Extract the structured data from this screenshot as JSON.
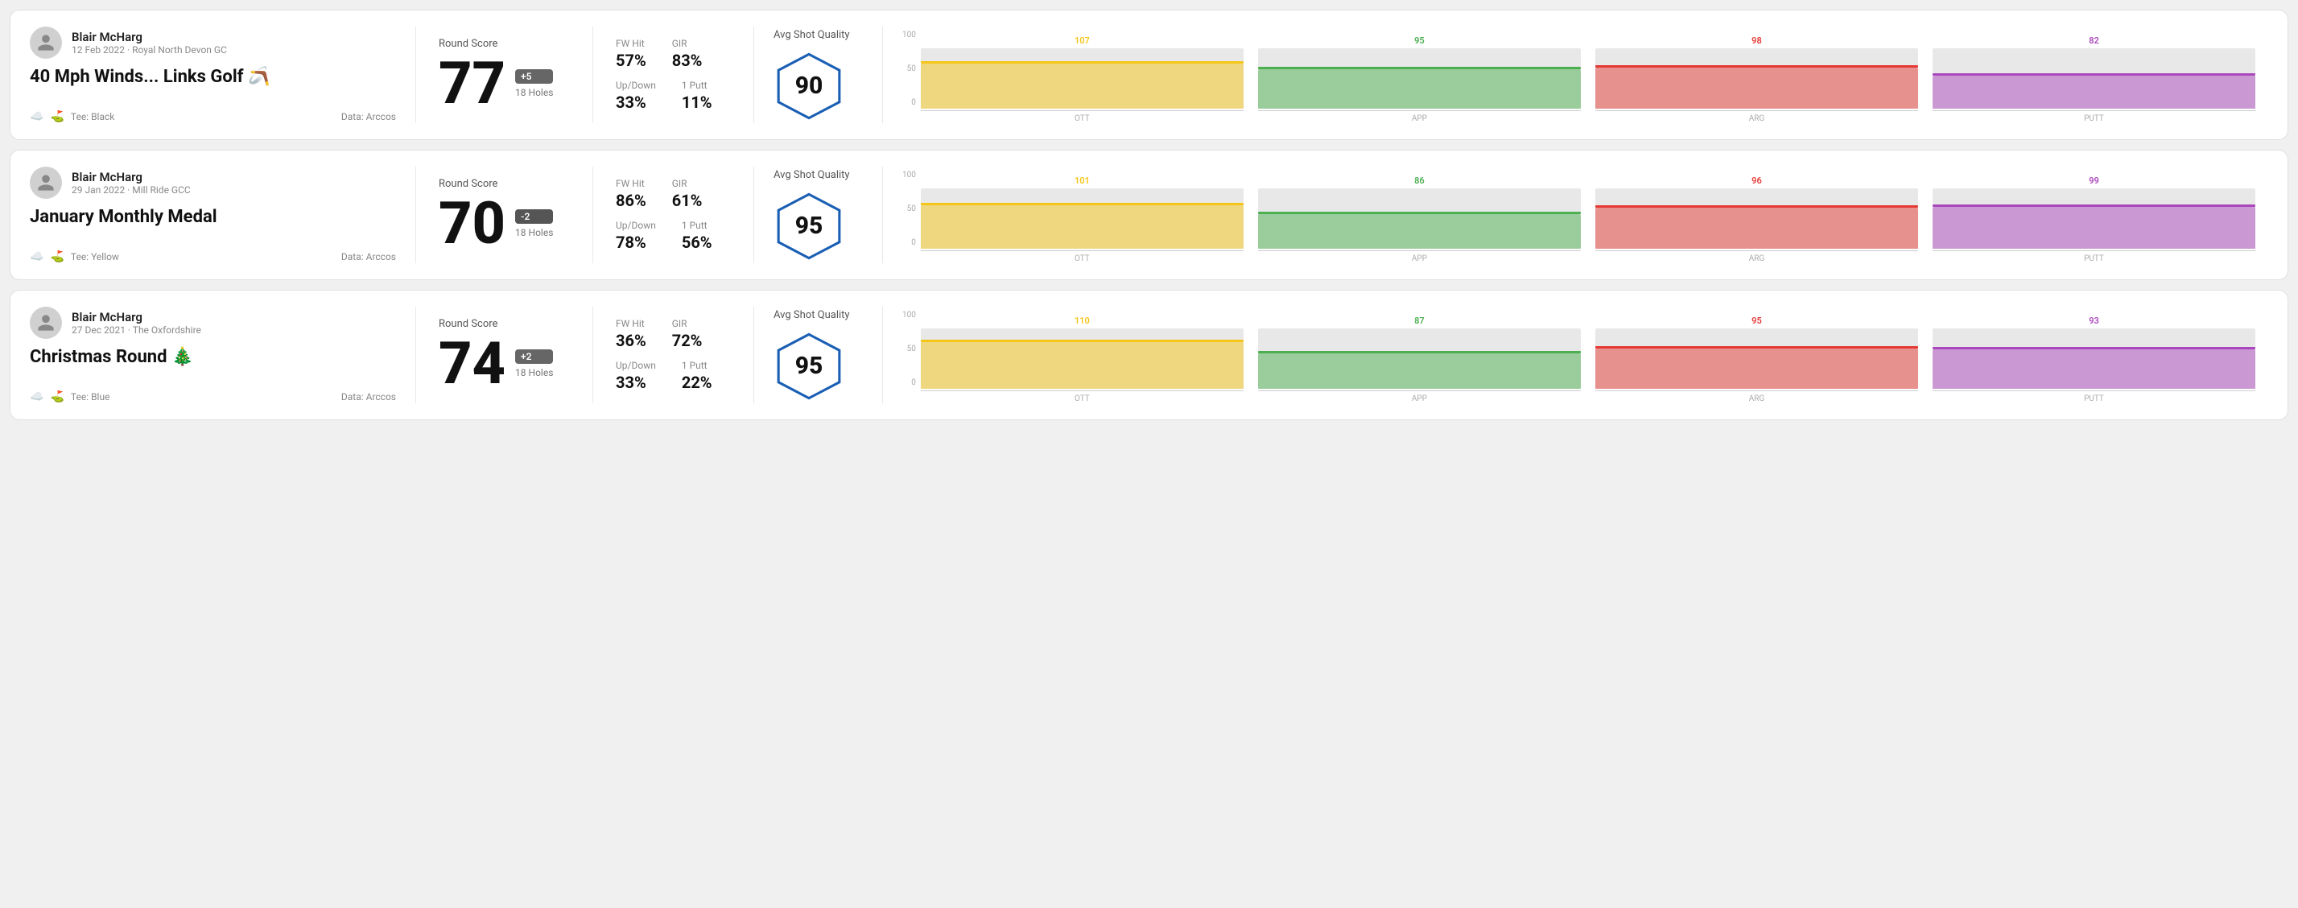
{
  "rounds": [
    {
      "id": "round-1",
      "player_name": "Blair McHarg",
      "player_meta": "12 Feb 2022 · Royal North Devon GC",
      "round_title": "40 Mph Winds... Links Golf 🪃",
      "tee": "Black",
      "data_source": "Data: Arccos",
      "round_score": "77",
      "score_badge": "+5",
      "score_badge_type": "positive",
      "holes": "18 Holes",
      "fw_hit": "57%",
      "gir": "83%",
      "up_down": "33%",
      "one_putt": "11%",
      "avg_shot_quality": "90",
      "chart": {
        "bars": [
          {
            "label": "OTT",
            "value": 107,
            "color": "#f5c518",
            "height_pct": 75
          },
          {
            "label": "APP",
            "value": 95,
            "color": "#4caf50",
            "height_pct": 65
          },
          {
            "label": "ARG",
            "value": 98,
            "color": "#e53935",
            "height_pct": 68
          },
          {
            "label": "PUTT",
            "value": 82,
            "color": "#ab47bc",
            "height_pct": 55
          }
        ]
      }
    },
    {
      "id": "round-2",
      "player_name": "Blair McHarg",
      "player_meta": "29 Jan 2022 · Mill Ride GCC",
      "round_title": "January Monthly Medal",
      "tee": "Yellow",
      "data_source": "Data: Arccos",
      "round_score": "70",
      "score_badge": "-2",
      "score_badge_type": "negative",
      "holes": "18 Holes",
      "fw_hit": "86%",
      "gir": "61%",
      "up_down": "78%",
      "one_putt": "56%",
      "avg_shot_quality": "95",
      "chart": {
        "bars": [
          {
            "label": "OTT",
            "value": 101,
            "color": "#f5c518",
            "height_pct": 72
          },
          {
            "label": "APP",
            "value": 86,
            "color": "#4caf50",
            "height_pct": 58
          },
          {
            "label": "ARG",
            "value": 96,
            "color": "#e53935",
            "height_pct": 68
          },
          {
            "label": "PUTT",
            "value": 99,
            "color": "#ab47bc",
            "height_pct": 70
          }
        ]
      }
    },
    {
      "id": "round-3",
      "player_name": "Blair McHarg",
      "player_meta": "27 Dec 2021 · The Oxfordshire",
      "round_title": "Christmas Round 🎄",
      "tee": "Blue",
      "data_source": "Data: Arccos",
      "round_score": "74",
      "score_badge": "+2",
      "score_badge_type": "positive",
      "holes": "18 Holes",
      "fw_hit": "36%",
      "gir": "72%",
      "up_down": "33%",
      "one_putt": "22%",
      "avg_shot_quality": "95",
      "chart": {
        "bars": [
          {
            "label": "OTT",
            "value": 110,
            "color": "#f5c518",
            "height_pct": 78
          },
          {
            "label": "APP",
            "value": 87,
            "color": "#4caf50",
            "height_pct": 59
          },
          {
            "label": "ARG",
            "value": 95,
            "color": "#e53935",
            "height_pct": 67
          },
          {
            "label": "PUTT",
            "value": 93,
            "color": "#ab47bc",
            "height_pct": 65
          }
        ]
      }
    }
  ],
  "labels": {
    "round_score": "Round Score",
    "avg_shot_quality": "Avg Shot Quality",
    "fw_hit": "FW Hit",
    "gir": "GIR",
    "up_down": "Up/Down",
    "one_putt": "1 Putt",
    "data_arccos": "Data: Arccos",
    "y_axis": [
      "100",
      "50",
      "0"
    ]
  }
}
